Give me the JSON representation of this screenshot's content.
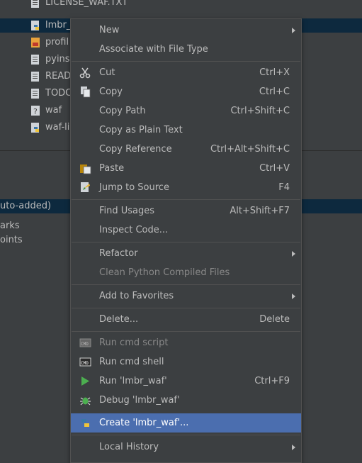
{
  "tree": {
    "rows": [
      {
        "label": "LICENSE_WAF.TXT"
      },
      {
        "label": "lmbr_"
      },
      {
        "label": "profil"
      },
      {
        "label": "pyinst"
      },
      {
        "label": "READ"
      },
      {
        "label": "TODC"
      },
      {
        "label": "waf"
      },
      {
        "label": "waf-li"
      }
    ]
  },
  "bottom_panel": {
    "rows": [
      {
        "label": "uto-added)"
      },
      {
        "label": "arks"
      },
      {
        "label": "oints"
      }
    ]
  },
  "menu": {
    "items": [
      {
        "label": "New",
        "shortcut": ""
      },
      {
        "label": "Associate with File Type",
        "shortcut": ""
      },
      {
        "label": "Cut",
        "shortcut": "Ctrl+X",
        "icon": "scissors-icon"
      },
      {
        "label": "Copy",
        "shortcut": "Ctrl+C",
        "icon": "copy-icon"
      },
      {
        "label": "Copy Path",
        "shortcut": "Ctrl+Shift+C"
      },
      {
        "label": "Copy as Plain Text",
        "shortcut": ""
      },
      {
        "label": "Copy Reference",
        "shortcut": "Ctrl+Alt+Shift+C"
      },
      {
        "label": "Paste",
        "shortcut": "Ctrl+V",
        "icon": "paste-icon"
      },
      {
        "label": "Jump to Source",
        "shortcut": "F4",
        "icon": "jump-to-source-icon"
      },
      {
        "label": "Find Usages",
        "shortcut": "Alt+Shift+F7"
      },
      {
        "label": "Inspect Code...",
        "shortcut": ""
      },
      {
        "label": "Refactor",
        "shortcut": ""
      },
      {
        "label": "Clean Python Compiled Files",
        "shortcut": ""
      },
      {
        "label": "Add to Favorites",
        "shortcut": ""
      },
      {
        "label": "Delete...",
        "shortcut": "Delete"
      },
      {
        "label": "Run cmd script",
        "shortcut": "",
        "icon": "cmd-icon"
      },
      {
        "label": "Run cmd shell",
        "shortcut": "",
        "icon": "cmd-icon"
      },
      {
        "label": "Run 'lmbr_waf'",
        "shortcut": "Ctrl+F9",
        "icon": "run-icon"
      },
      {
        "label": "Debug 'lmbr_waf'",
        "shortcut": "",
        "icon": "debug-icon"
      },
      {
        "label": "Create 'lmbr_waf'...",
        "shortcut": "",
        "icon": "python-icon"
      },
      {
        "label": "Local History",
        "shortcut": ""
      }
    ]
  },
  "colors": {
    "menu_bg": "#3c3f41",
    "selection": "#4b6eaf",
    "text": "#bbbbbb",
    "disabled_text": "#888888"
  }
}
